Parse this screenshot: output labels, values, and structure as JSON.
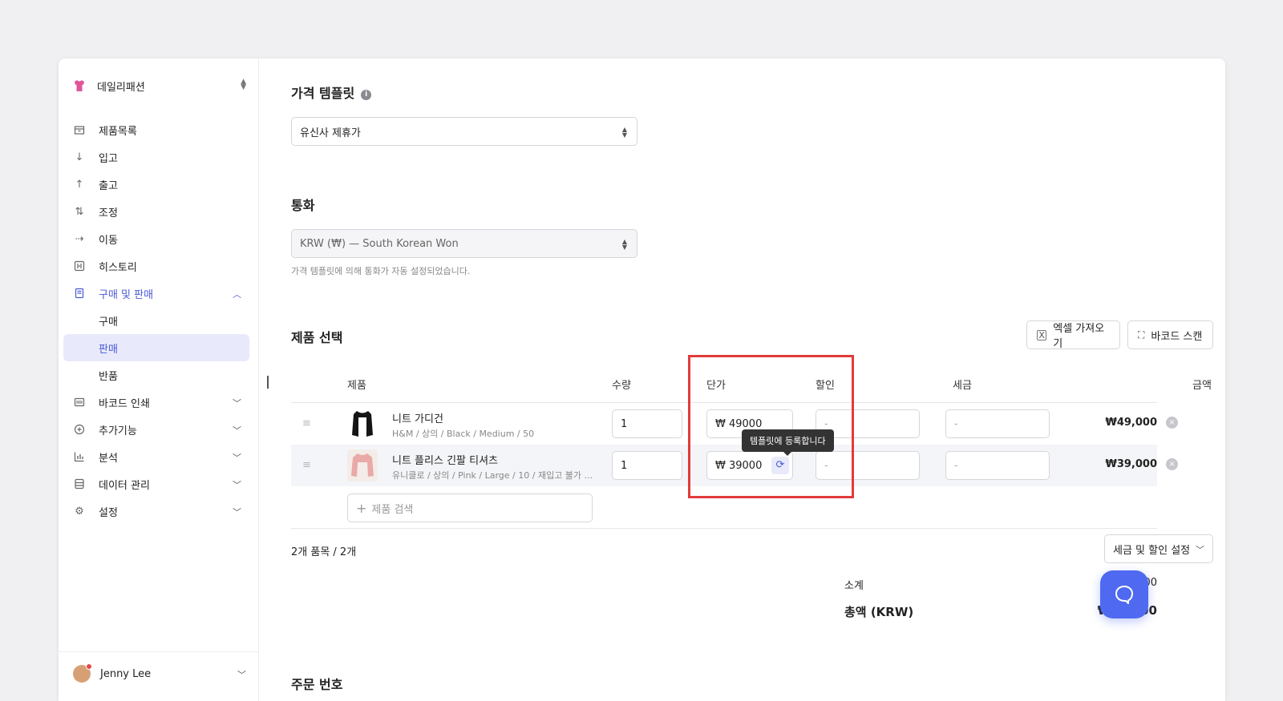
{
  "sidebar": {
    "brand": "데일리패션",
    "items": [
      {
        "label": "제품목록",
        "icon": "box-icon"
      },
      {
        "label": "입고",
        "icon": "arrow-down-icon"
      },
      {
        "label": "출고",
        "icon": "arrow-up-icon"
      },
      {
        "label": "조정",
        "icon": "swap-icon"
      },
      {
        "label": "이동",
        "icon": "arrow-right-icon"
      },
      {
        "label": "히스토리",
        "icon": "history-icon"
      },
      {
        "label": "구매 및 판매",
        "icon": "document-icon"
      }
    ],
    "sub_items": [
      "구매",
      "판매",
      "반품"
    ],
    "more_items": [
      {
        "label": "바코드 인쇄",
        "icon": "barcode-icon"
      },
      {
        "label": "추가기능",
        "icon": "plus-circle-icon"
      },
      {
        "label": "분석",
        "icon": "chart-icon"
      },
      {
        "label": "데이터 관리",
        "icon": "database-icon"
      },
      {
        "label": "설정",
        "icon": "gear-icon"
      }
    ],
    "user": "Jenny Lee"
  },
  "price_template": {
    "title": "가격 템플릿",
    "selected": "유신사 제휴가"
  },
  "currency": {
    "title": "통화",
    "selected": "KRW (₩) — South Korean Won",
    "hint": "가격 템플릿에 의해 통화가 자동 설정되었습니다."
  },
  "products": {
    "title": "제품 선택",
    "excel_button": "엑셀 가져오기",
    "barcode_button": "바코드 스캔",
    "headers": {
      "product": "제품",
      "qty": "수량",
      "unit_price": "단가",
      "discount": "할인",
      "tax": "세금",
      "amount": "금액"
    },
    "rows": [
      {
        "name": "니트 가디건",
        "meta": "H&M / 상의 / Black / Medium / 50",
        "qty": "1",
        "price": "₩ 49000",
        "discount": "-",
        "tax": "-",
        "amount": "₩49,000"
      },
      {
        "name": "니트 플리스 긴팔 티셔츠",
        "meta": "유니클로 / 상의 / Pink / Large / 10 / 재입고 불가 ...",
        "qty": "1",
        "price": "₩ 39000",
        "discount": "-",
        "tax": "-",
        "amount": "₩39,000"
      }
    ],
    "tooltip": "템플릿에 등록합니다",
    "search_placeholder": "제품 검색",
    "count_text": "2개 품목 / 2개",
    "settings_button": "세금 및 할인 설정",
    "subtotal_label": "소계",
    "subtotal_value": "₩88,000",
    "total_label": "총액 (KRW)",
    "total_value": "₩88,000"
  },
  "order": {
    "title": "주문 번호"
  },
  "colors": {
    "accent": "#4a59d6",
    "highlight": "#e23b3b",
    "fab": "#4f6af0"
  }
}
